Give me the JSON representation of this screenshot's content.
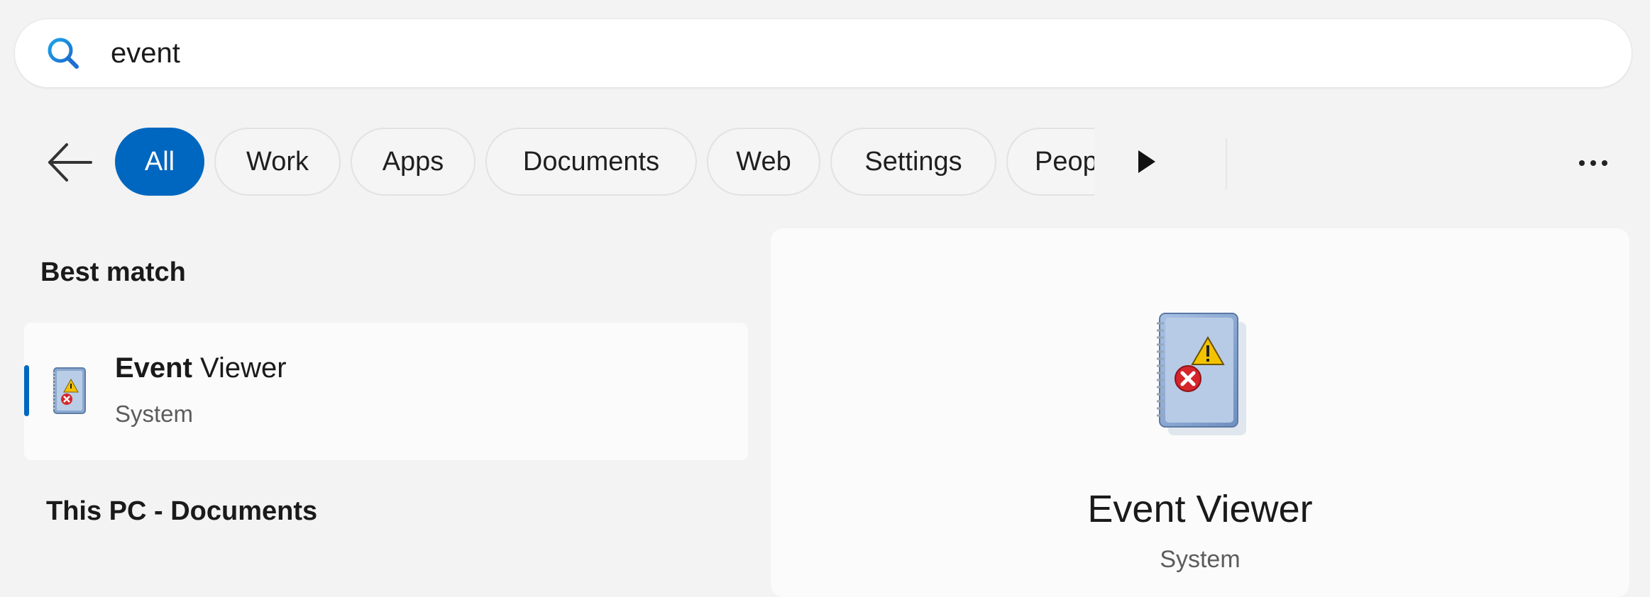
{
  "search": {
    "query": "event",
    "icon": "search-icon"
  },
  "filters": {
    "items": [
      {
        "label": "All",
        "active": true
      },
      {
        "label": "Work",
        "active": false
      },
      {
        "label": "Apps",
        "active": false
      },
      {
        "label": "Documents",
        "active": false
      },
      {
        "label": "Web",
        "active": false
      },
      {
        "label": "Settings",
        "active": false
      },
      {
        "label": "Peop",
        "active": false
      }
    ]
  },
  "results": {
    "best_match_title": "Best match",
    "best_match": {
      "title_bold": "Event",
      "title_rest": " Viewer",
      "subtitle": "System",
      "icon": "event-viewer-icon"
    },
    "documents_section_title": "This PC - Documents"
  },
  "preview": {
    "title": "Event Viewer",
    "subtitle": "System",
    "icon": "event-viewer-icon"
  },
  "colors": {
    "accent": "#0067c0",
    "background": "#f3f3f3",
    "panel": "#fbfbfb"
  }
}
